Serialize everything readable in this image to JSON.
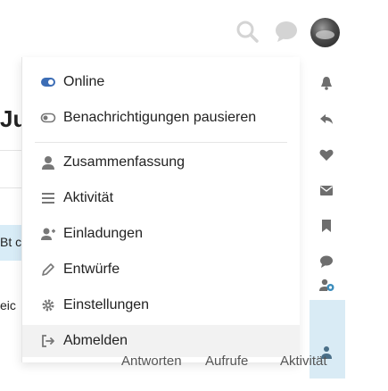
{
  "background": {
    "fragments": [
      "Ju",
      "Bt c",
      "eic"
    ]
  },
  "header": {
    "icons": [
      "search-icon",
      "chat-icon",
      "user-avatar"
    ]
  },
  "menu": {
    "items": [
      {
        "label": "Online",
        "icon": "status-online-icon"
      },
      {
        "label": "Benachrichtigungen pausieren",
        "icon": "toggle-off-icon"
      },
      {
        "label": "Zusammenfassung",
        "icon": "user-icon"
      },
      {
        "label": "Aktivität",
        "icon": "list-icon"
      },
      {
        "label": "Einladungen",
        "icon": "user-plus-icon"
      },
      {
        "label": "Entwürfe",
        "icon": "pencil-icon"
      },
      {
        "label": "Einstellungen",
        "icon": "cog-icon"
      },
      {
        "label": "Abmelden",
        "icon": "sign-out-icon"
      }
    ],
    "active_item": "Abmelden"
  },
  "side_icons": [
    "bell-icon",
    "reply-icon",
    "heart-icon",
    "envelope-icon",
    "bookmark-icon",
    "comment-icon",
    "user-badge-icon",
    "user-icon"
  ],
  "tabs": {
    "answers": "Antworten",
    "views": "Aufrufe",
    "activity": "Aktivität"
  },
  "colors": {
    "accent_light": "#d9ebf5",
    "icon_grey": "#6e6e6e",
    "text": "#222222"
  }
}
